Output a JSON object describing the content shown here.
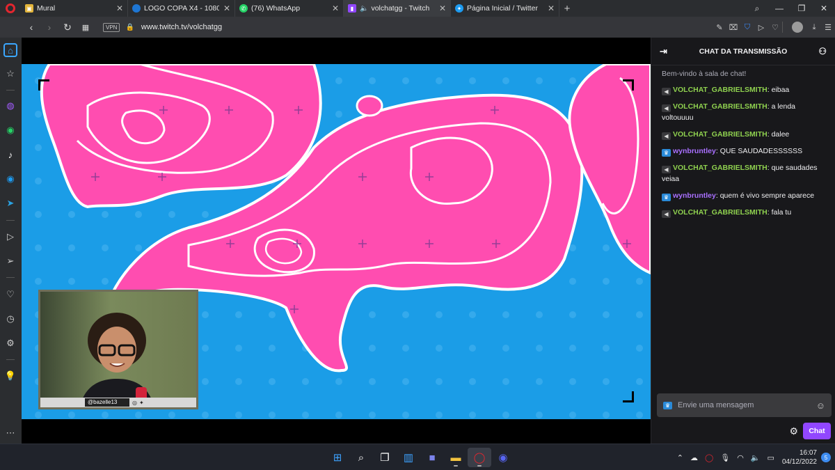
{
  "browser": {
    "tabs": [
      {
        "title": "Mural",
        "icon": "image-icon",
        "color": "#e3b53b"
      },
      {
        "title": "LOGO COPA X4 - 1080 px …",
        "icon": "opera-icon",
        "color": "#1e76d3"
      },
      {
        "title": "(76) WhatsApp",
        "icon": "whatsapp-icon",
        "color": "#25d366"
      },
      {
        "title": "volchatgg - Twitch",
        "icon": "twitch-icon",
        "color": "#9147ff"
      },
      {
        "title": "Página Inicial / Twitter",
        "icon": "twitter-icon",
        "color": "#1d9bf0"
      }
    ],
    "active_tab": 3,
    "vpn_label": "VPN",
    "url": "www.twitch.tv/volchatgg"
  },
  "webcam": {
    "handle": "@bazelle13"
  },
  "chat": {
    "title": "CHAT DA TRANSMISSÃO",
    "welcome": "Bem-vindo à sala de chat!",
    "messages": [
      {
        "user": "VOLCHAT_GABRIELSMITH",
        "badge": "mute",
        "color": "#8fd14f",
        "text": "eibaa"
      },
      {
        "user": "VOLCHAT_GABRIELSMITH",
        "badge": "mute",
        "color": "#8fd14f",
        "text": "a lenda voltouuuu"
      },
      {
        "user": "VOLCHAT_GABRIELSMITH",
        "badge": "mute",
        "color": "#8fd14f",
        "text": "dalee"
      },
      {
        "user": "wynbruntley",
        "badge": "crown",
        "color": "#a970ff",
        "text": "QUE SAUDADESSSSSS"
      },
      {
        "user": "VOLCHAT_GABRIELSMITH",
        "badge": "mute",
        "color": "#8fd14f",
        "text": "que saudades veiaa"
      },
      {
        "user": "wynbruntley",
        "badge": "crown",
        "color": "#a970ff",
        "text": "quem é vivo sempre aparece"
      },
      {
        "user": "VOLCHAT_GABRIELSMITH",
        "badge": "mute",
        "color": "#8fd14f",
        "text": "fala tu"
      }
    ],
    "input_placeholder": "Envie uma mensagem",
    "send_label": "Chat"
  },
  "taskbar": {
    "time": "16:07",
    "date": "04/12/2022",
    "notification_count": "5"
  },
  "colors": {
    "stream_blue": "#1b9de7",
    "stream_pink": "#ff4db0",
    "twitch_purple": "#9147ff"
  }
}
